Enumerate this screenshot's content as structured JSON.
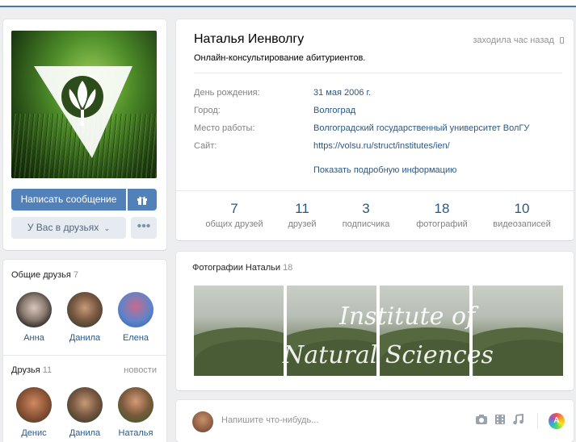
{
  "profile": {
    "name": "Наталья Иенволгу",
    "online_status": "заходила час назад",
    "status_text": "Онлайн-консультирование абитуриентов.",
    "write_message": "Написать сообщение",
    "friends_state": "У Вас в друзьях",
    "more": "•••"
  },
  "info": {
    "rows": [
      {
        "label": "День рождения:",
        "value": "31 мая 2006 г."
      },
      {
        "label": "Город:",
        "value": "Волгоград"
      },
      {
        "label": "Место работы:",
        "value": "Волгоградский государственный университет ВолГУ"
      },
      {
        "label": "Сайт:",
        "value": "https://volsu.ru/struct/institutes/ien/"
      }
    ],
    "show_more": "Показать подробную информацию"
  },
  "counters": [
    {
      "number": "7",
      "label": "общих друзей"
    },
    {
      "number": "11",
      "label": "друзей"
    },
    {
      "number": "3",
      "label": "подписчика"
    },
    {
      "number": "18",
      "label": "фотографий"
    },
    {
      "number": "10",
      "label": "видеозаписей"
    }
  ],
  "mutual_friends": {
    "title": "Общие друзья",
    "count": "7",
    "people": [
      {
        "name": "Анна"
      },
      {
        "name": "Данила"
      },
      {
        "name": "Елена"
      }
    ]
  },
  "friends": {
    "title": "Друзья",
    "count": "11",
    "news": "новости",
    "people": [
      {
        "name": "Денис"
      },
      {
        "name": "Данила"
      },
      {
        "name": "Наталья"
      }
    ]
  },
  "photos": {
    "title": "Фотографии Натальи",
    "count": "18",
    "overlay_line1": "Institute of",
    "overlay_line2": "Natural Sciences"
  },
  "post": {
    "placeholder": "Напишите что-нибудь...",
    "icons": [
      "camera-icon",
      "video-icon",
      "music-icon",
      "color-circle-icon"
    ]
  },
  "colors": {
    "accent": "#5181b8",
    "link": "#2a5885",
    "muted": "#828282"
  }
}
